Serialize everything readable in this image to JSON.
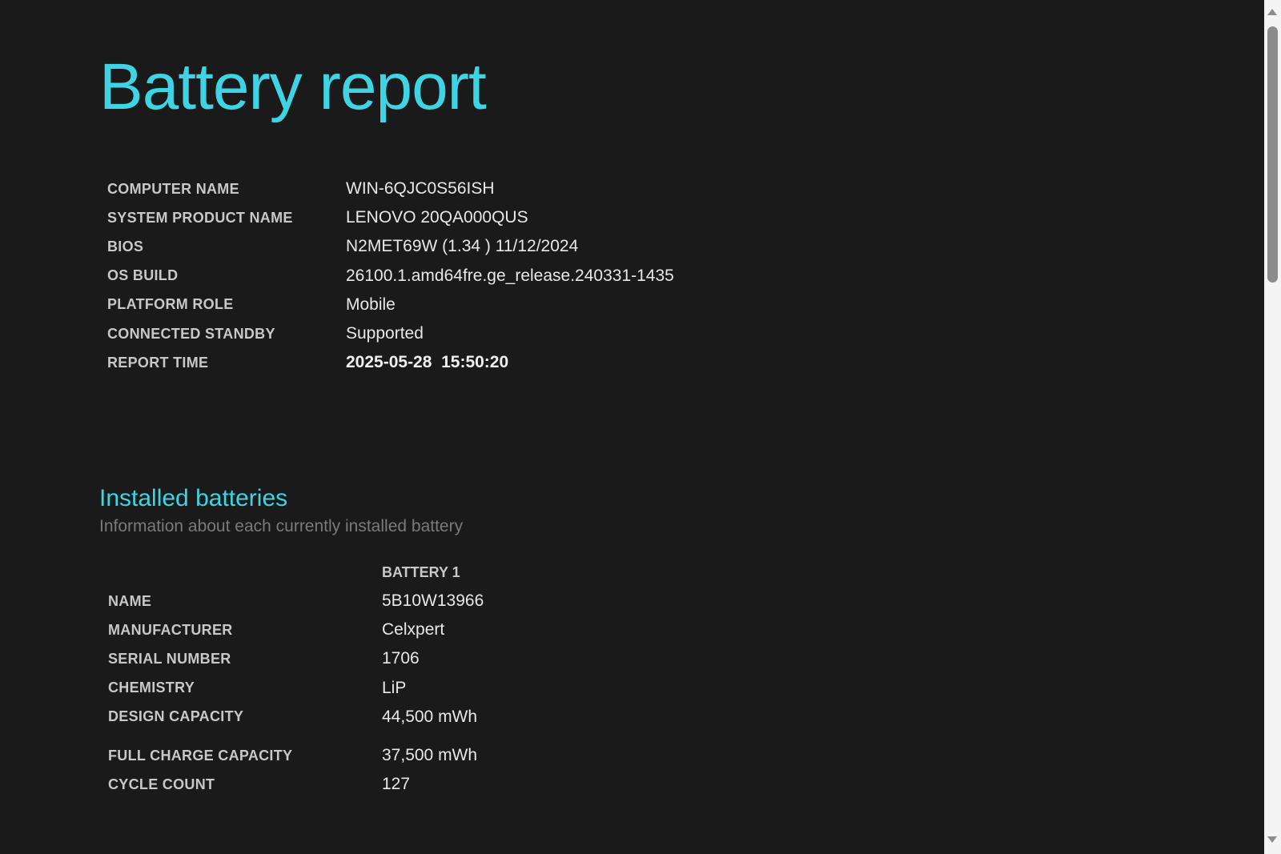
{
  "title": "Battery report",
  "system_info": [
    {
      "label": "COMPUTER NAME",
      "value": "WIN-6QJC0S56ISH"
    },
    {
      "label": "SYSTEM PRODUCT NAME",
      "value": "LENOVO 20QA000QUS"
    },
    {
      "label": "BIOS",
      "value": "N2MET69W (1.34 ) 11/12/2024"
    },
    {
      "label": "OS BUILD",
      "value": "26100.1.amd64fre.ge_release.240331-1435"
    },
    {
      "label": "PLATFORM ROLE",
      "value": "Mobile"
    },
    {
      "label": "CONNECTED STANDBY",
      "value": "Supported"
    },
    {
      "label": "REPORT TIME",
      "value": "2025-05-28  15:50:20"
    }
  ],
  "installed_batteries": {
    "heading": "Installed batteries",
    "subtitle": "Information about each currently installed battery",
    "column": "BATTERY 1",
    "rows": [
      {
        "label": "NAME",
        "value": "5B10W13966"
      },
      {
        "label": "MANUFACTURER",
        "value": "Celxpert"
      },
      {
        "label": "SERIAL NUMBER",
        "value": "1706"
      },
      {
        "label": "CHEMISTRY",
        "value": "LiP"
      },
      {
        "label": "DESIGN CAPACITY",
        "value": "44,500 mWh"
      },
      {
        "label": "FULL CHARGE CAPACITY",
        "value": "37,500 mWh"
      },
      {
        "label": "CYCLE COUNT",
        "value": "127"
      }
    ]
  }
}
